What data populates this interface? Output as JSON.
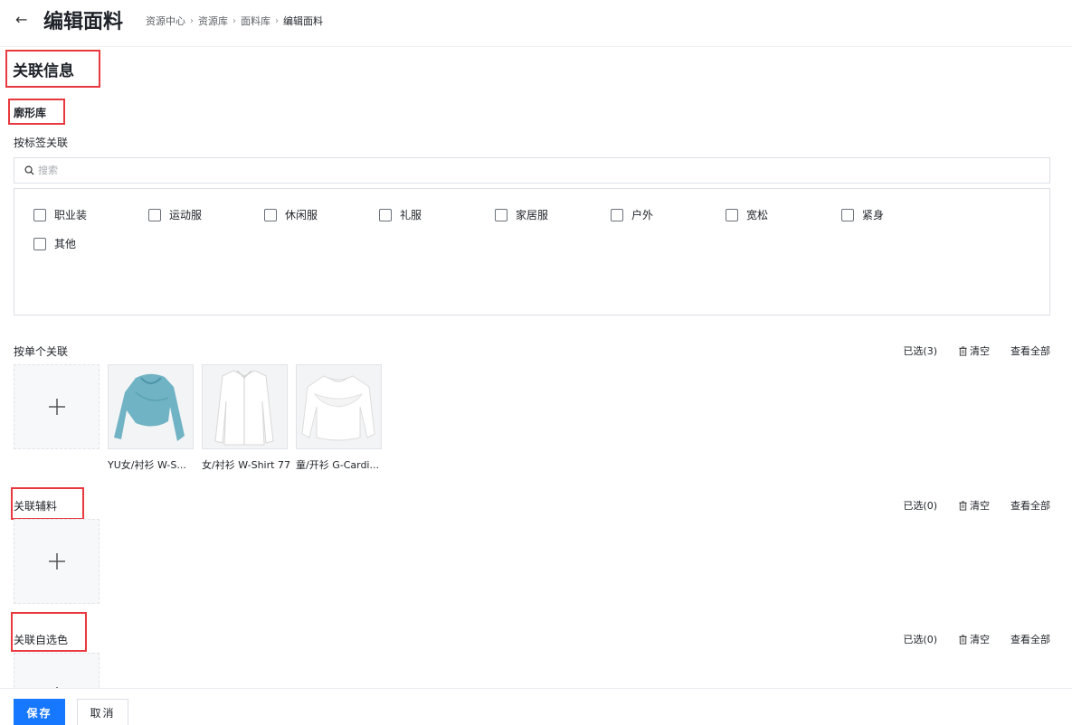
{
  "header": {
    "back_icon": "left-arrow-icon",
    "title": "编辑面料",
    "breadcrumb": [
      "资源中心",
      "资源库",
      "面料库",
      "编辑面料"
    ],
    "breadcrumb_separator": "›"
  },
  "section": {
    "title": "关联信息"
  },
  "silhouette_library": {
    "title": "廓形库",
    "by_tag_label": "按标签关联",
    "search": {
      "placeholder": "搜索",
      "value": "",
      "icon": "search-icon"
    },
    "tags": [
      "职业装",
      "运动服",
      "休闲服",
      "礼服",
      "家居服",
      "户外",
      "宽松",
      "紧身",
      "其他"
    ]
  },
  "single_association": {
    "label": "按单个关联",
    "selected": "已选(3)",
    "clear": "清空",
    "view_all": "查看全部",
    "add_icon": "plus-icon",
    "items": [
      {
        "caption": "YU女/衬衫 W-S...",
        "color": "#6fb3c4"
      },
      {
        "caption": "女/衬衫 W-Shirt 77",
        "color": "#f0f0f0"
      },
      {
        "caption": "童/开衫 G-Cardi...",
        "color": "#f4f4f4"
      }
    ]
  },
  "linked_trims": {
    "label": "关联辅料",
    "selected": "已选(0)",
    "clear": "清空",
    "view_all": "查看全部"
  },
  "linked_colors": {
    "label": "关联自选色",
    "selected": "已选(0)",
    "clear": "清空",
    "view_all": "查看全部"
  },
  "footer": {
    "save": "保存",
    "cancel": "取消"
  },
  "colors": {
    "primary": "#1677ff",
    "highlight_box": "#e8393f"
  }
}
